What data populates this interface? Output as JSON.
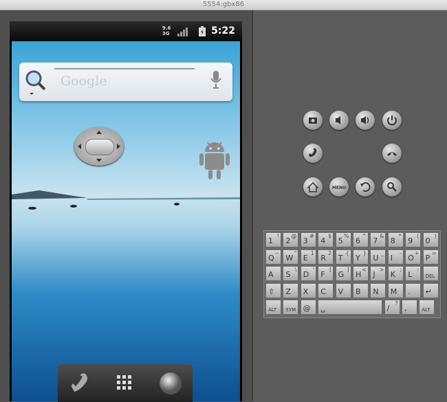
{
  "window": {
    "title": "5554:gbx86"
  },
  "statusbar": {
    "network": "3G",
    "network_top": "9.6",
    "time": "5:22"
  },
  "search": {
    "placeholder": "Google"
  },
  "keyboard": {
    "rows": [
      [
        [
          "1",
          "!"
        ],
        [
          "2",
          "@"
        ],
        [
          "3",
          "#"
        ],
        [
          "4",
          "$"
        ],
        [
          "5",
          "%"
        ],
        [
          "6",
          "^"
        ],
        [
          "7",
          "&"
        ],
        [
          "8",
          "*"
        ],
        [
          "9",
          "("
        ],
        [
          "0",
          ")"
        ]
      ],
      [
        [
          "Q",
          "~"
        ],
        [
          "W",
          "\""
        ],
        [
          "E",
          "1"
        ],
        [
          "R",
          "2"
        ],
        [
          "T",
          "{"
        ],
        [
          "Y",
          "}"
        ],
        [
          "U",
          "_"
        ],
        [
          "I",
          "-"
        ],
        [
          "O",
          "+"
        ],
        [
          "P",
          "="
        ]
      ],
      [
        [
          "A",
          ""
        ],
        [
          "S",
          "\\"
        ],
        [
          "D",
          "'"
        ],
        [
          "F",
          "["
        ],
        [
          "G",
          "]"
        ],
        [
          "H",
          "<"
        ],
        [
          "J",
          ">"
        ],
        [
          "K",
          ";"
        ],
        [
          "L",
          ":"
        ],
        [
          "DEL",
          ""
        ]
      ],
      [
        [
          "⇧",
          ""
        ],
        [
          "Z",
          ""
        ],
        [
          "X",
          ""
        ],
        [
          "C",
          ""
        ],
        [
          "V",
          ""
        ],
        [
          "B",
          ""
        ],
        [
          "N",
          ""
        ],
        [
          "M",
          ""
        ],
        [
          ".",
          ""
        ],
        [
          "↵",
          ""
        ]
      ],
      [
        [
          "ALT",
          ""
        ],
        [
          "SYM",
          ""
        ],
        [
          "@",
          ""
        ],
        [
          "␣",
          ""
        ],
        [
          "/",
          "?"
        ],
        [
          ",",
          ""
        ],
        [
          "ALT",
          ""
        ]
      ]
    ]
  }
}
